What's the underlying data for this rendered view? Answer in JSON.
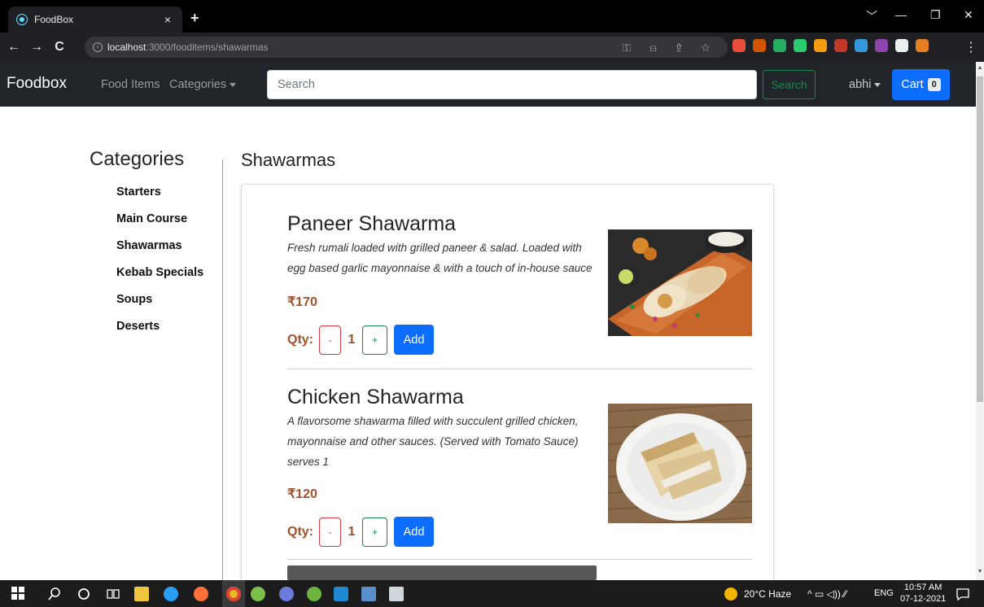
{
  "browser": {
    "tab_title": "FoodBox",
    "tab_close": "×",
    "new_tab": "+",
    "window_controls": [
      "﹀",
      "—",
      "❐",
      "✕"
    ],
    "url_host": "localhost",
    "url_path": ":3000/fooditems/shawarmas",
    "info_symbol": "i",
    "nav_back": "←",
    "nav_forward": "→",
    "nav_reload": "C",
    "omni_icons": "⚿ ⊟ ⇪ ☆",
    "menu": "⋮",
    "extension_colors": [
      "#e74c3c",
      "#d35400",
      "#27ae60",
      "#2ecc71",
      "#f39c12",
      "#c0392b",
      "#3498db",
      "#8e44ad",
      "#ecf0f1",
      "#e67e22"
    ]
  },
  "navbar": {
    "brand": "Foodbox",
    "food_items": "Food Items",
    "categories": "Categories",
    "search_placeholder": "Search",
    "search_button": "Search",
    "user": "abhi",
    "cart_label": "Cart",
    "cart_count": "0"
  },
  "sidebar": {
    "title": "Categories",
    "items": [
      "Starters",
      "Main Course",
      "Shawarmas",
      "Kebab Specials",
      "Soups",
      "Deserts"
    ]
  },
  "main": {
    "title": "Shawarmas",
    "items": [
      {
        "name": "Paneer Shawarma",
        "description": "Fresh rumali loaded with grilled paneer & salad. Loaded with egg based garlic mayonnaise & with a touch of in-house sauce",
        "price": "₹170",
        "qty_label": "Qty:",
        "minus": "-",
        "qty": "1",
        "plus": "+",
        "add": "Add"
      },
      {
        "name": "Chicken Shawarma",
        "description": "A flavorsome shawarma filled with succulent grilled chicken, mayonnaise and other sauces. (Served with Tomato Sauce) serves 1",
        "price": "₹120",
        "qty_label": "Qty:",
        "minus": "-",
        "qty": "1",
        "plus": "+",
        "add": "Add"
      }
    ]
  },
  "taskbar": {
    "weather": "20°C Haze",
    "lang": "ENG",
    "time": "10:57 AM",
    "date": "07-12-2021",
    "tray_icons": "^ ▭ ◁)) ⁄⁄"
  }
}
